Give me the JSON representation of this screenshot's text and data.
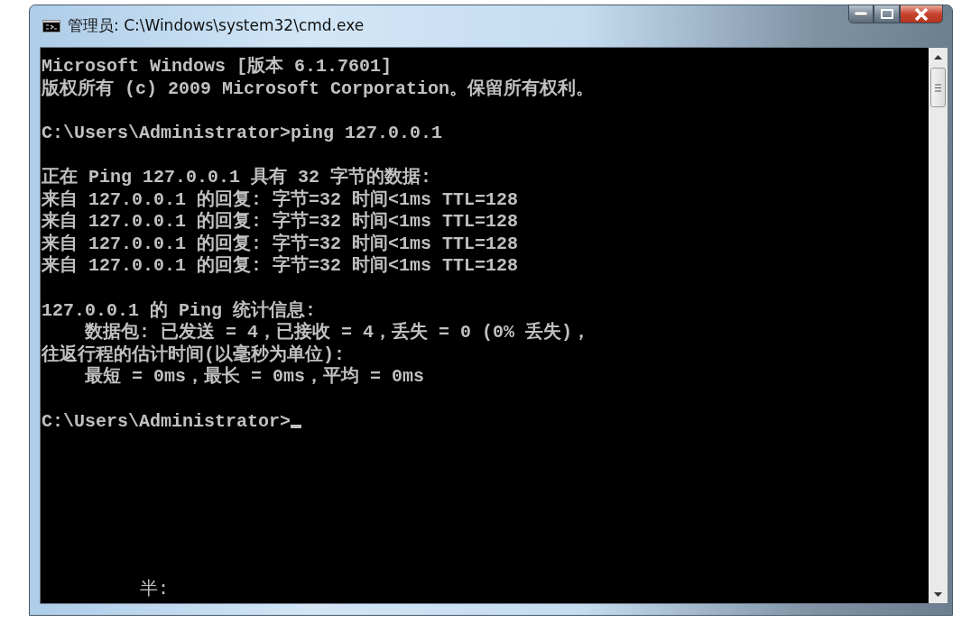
{
  "window": {
    "title": "管理员: C:\\Windows\\system32\\cmd.exe"
  },
  "console": {
    "blocks": [
      {
        "lines": [
          "Microsoft Windows [版本 6.1.7601]",
          "版权所有 (c) 2009 Microsoft Corporation。保留所有权利。"
        ]
      },
      {
        "lines": [
          "C:\\Users\\Administrator>ping 127.0.0.1"
        ]
      },
      {
        "lines": [
          "正在 Ping 127.0.0.1 具有 32 字节的数据:",
          "来自 127.0.0.1 的回复: 字节=32 时间<1ms TTL=128",
          "来自 127.0.0.1 的回复: 字节=32 时间<1ms TTL=128",
          "来自 127.0.0.1 的回复: 字节=32 时间<1ms TTL=128",
          "来自 127.0.0.1 的回复: 字节=32 时间<1ms TTL=128"
        ]
      },
      {
        "lines": [
          "127.0.0.1 的 Ping 统计信息:",
          "    数据包: 已发送 = 4，已接收 = 4，丢失 = 0 (0% 丢失)，",
          "往返行程的估计时间(以毫秒为单位):",
          "    最短 = 0ms，最长 = 0ms，平均 = 0ms"
        ]
      },
      {
        "lines": [
          "C:\\Users\\Administrator>"
        ],
        "cursor": true
      }
    ],
    "ime_status": "半:"
  }
}
